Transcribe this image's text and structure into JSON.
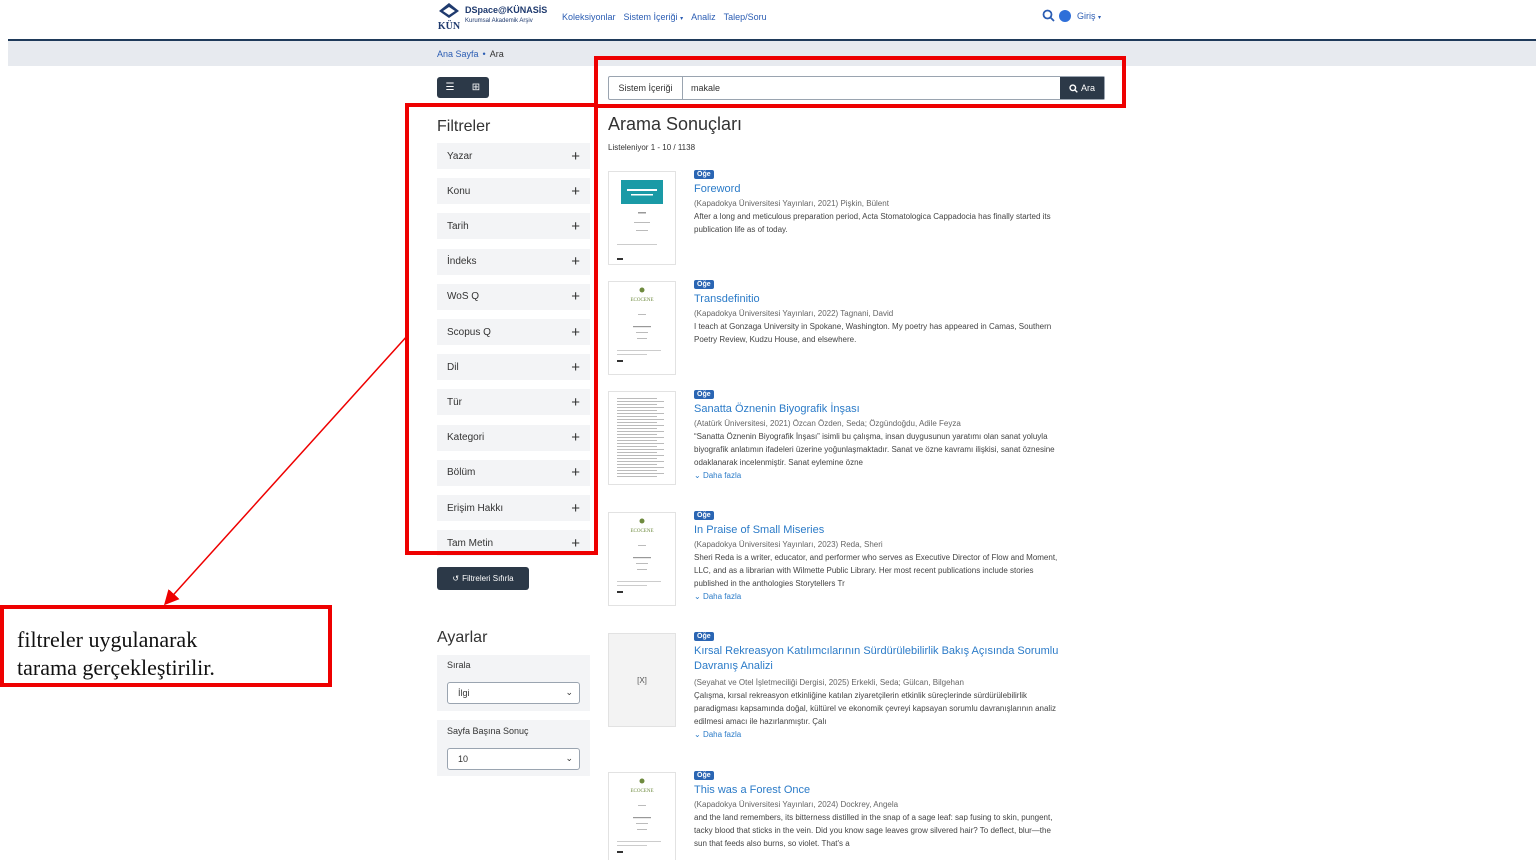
{
  "header": {
    "logo_title": "DSpace@KÜNASİS",
    "logo_subtitle": "Kurumsal Akademik Arşiv",
    "logo_mark": "KÜN",
    "nav": [
      {
        "label": "Koleksiyonlar",
        "dropdown": false
      },
      {
        "label": "Sistem İçeriği",
        "dropdown": true
      },
      {
        "label": "Analiz",
        "dropdown": false
      },
      {
        "label": "Talep/Soru",
        "dropdown": false
      }
    ],
    "login_label": "Giriş"
  },
  "breadcrumb": {
    "home": "Ana Sayfa",
    "current": "Ara"
  },
  "search": {
    "scope": "Sistem İçeriği",
    "query": "makale",
    "button": "Ara"
  },
  "filters": {
    "title": "Filtreler",
    "items": [
      "Yazar",
      "Konu",
      "Tarih",
      "İndeks",
      "WoS Q",
      "Scopus Q",
      "Dil",
      "Tür",
      "Kategori",
      "Bölüm",
      "Erişim Hakkı",
      "Tam Metin"
    ],
    "reset_label": "Filtreleri Sıfırla"
  },
  "settings": {
    "title": "Ayarlar",
    "sort_label": "Sırala",
    "sort_value": "İlgi",
    "per_page_label": "Sayfa Başına Sonuç",
    "per_page_value": "10"
  },
  "results": {
    "title": "Arama Sonuçları",
    "count": "Listeleniyor 1 - 10 / 1138",
    "badge": "Öğe",
    "more_label": "Daha fazla",
    "missing_thumb": "[X]",
    "items": [
      {
        "title": "Foreword",
        "meta": "(Kapadokya Üniversitesi Yayınları, 2021) Pişkin, Bülent",
        "abstract": "After a long and meticulous preparation period, Acta Stomatologica Cappadocia has finally started its publication life as of today.",
        "has_more": false,
        "thumb": "cover-teal"
      },
      {
        "title": "Transdefinitio",
        "meta": "(Kapadokya Üniversitesi Yayınları, 2022) Tagnani, David",
        "abstract": "I teach at Gonzaga University in Spokane, Washington. My poetry has appeared in Camas, Southern Poetry Review, Kudzu House, and elsewhere.",
        "has_more": false,
        "thumb": "ecocene"
      },
      {
        "title": "Sanatta Öznenin Biyografik İnşası",
        "meta": "(Atatürk Üniversitesi, 2021) Özcan Özden, Seda; Özgündoğdu, Adile Feyza",
        "abstract": "“Sanatta Öznenin Biyografik İnşası” isimli bu çalışma, insan duygusunun yaratımı olan sanat yoluyla biyografik anlatımın ifadeleri üzerine yoğunlaşmaktadır. Sanat ve özne kavramı ilişkisi, sanat öznesine odaklanarak incelenmiştir. Sanat eylemine özne",
        "has_more": true,
        "thumb": "text-page"
      },
      {
        "title": "In Praise of Small Miseries",
        "meta": "(Kapadokya Üniversitesi Yayınları, 2023) Reda, Sheri",
        "abstract": "Sheri Reda is a writer, educator, and performer who serves as Executive Director of Flow and Moment, LLC, and as a librarian with Wilmette Public Library. Her most recent publications include stories published in the anthologies Storytellers Tr",
        "has_more": true,
        "thumb": "ecocene"
      },
      {
        "title": "Kırsal Rekreasyon Katılımcılarının Sürdürülebilirlik Bakış Açısında Sorumlu Davranış Analizi",
        "meta": "(Seyahat ve Otel İşletmeciliği Dergisi, 2025) Erkekli, Seda; Gülcan, Bilgehan",
        "abstract": "Çalışma, kırsal rekreasyon etkinliğine katılan ziyaretçilerin etkinlik süreçlerinde sürdürülebilirlik paradigması kapsamında doğal, kültürel ve ekonomik çevreyi kapsayan sorumlu davranışlarının analiz edilmesi amacı ile hazırlanmıştır. Çalı",
        "has_more": true,
        "thumb": "missing"
      },
      {
        "title": "This was a Forest Once",
        "meta": "(Kapadokya Üniversitesi Yayınları, 2024) Dockrey, Angela",
        "abstract": "and the land remembers, its bitterness distilled in the snap of a sage leaf: sap fusing to skin, pungent, tacky blood that sticks in the vein. Did you know sage leaves grow silvered hair? To deflect, blur—the sun that feeds also burns, so violet. That's a",
        "has_more": false,
        "thumb": "ecocene"
      }
    ]
  },
  "annotation": {
    "line1": "filtreler uygulanarak",
    "line2": "tarama gerçekleştirilir.",
    "color": "#ee0000"
  }
}
